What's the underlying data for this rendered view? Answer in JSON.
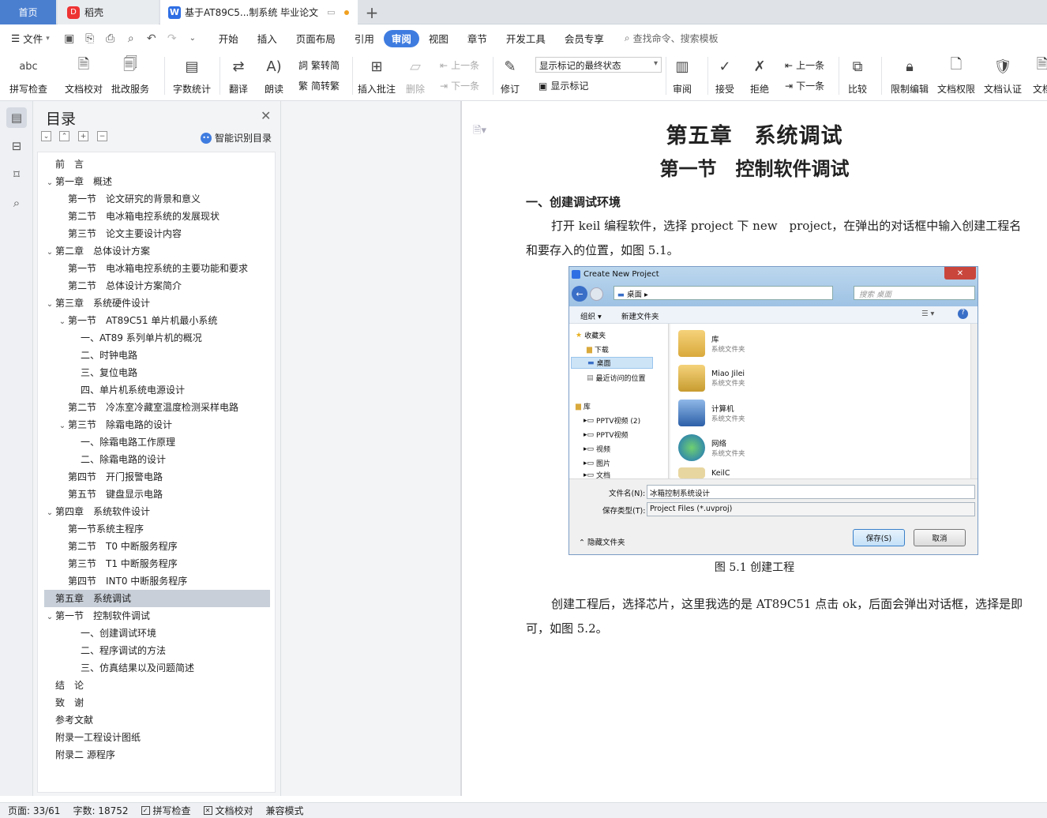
{
  "tabs": {
    "home": "首页",
    "daoke": "稻壳",
    "doc": "基于AT89C5...制系统 毕业论文"
  },
  "menu": {
    "file": "文件",
    "items": [
      "开始",
      "插入",
      "页面布局",
      "引用",
      "审阅",
      "视图",
      "章节",
      "开发工具",
      "会员专享"
    ],
    "active": "审阅",
    "search": "查找命令、搜索模板"
  },
  "ribbon": {
    "spell": "拼写检查",
    "proof": "文档校对",
    "annotate_service": "批改服务",
    "wordcount": "字数统计",
    "translate": "翻译",
    "read": "朗读",
    "trad2simp": "繁转简",
    "simp2trad": "简转繁",
    "insert_comment": "插入批注",
    "delete": "删除",
    "prev_comment": "上一条",
    "next_comment": "下一条",
    "revise": "修订",
    "track_mode": "显示标记的最终状态",
    "show_markup": "显示标记",
    "review": "审阅",
    "accept": "接受",
    "reject": "拒绝",
    "prev": "上一条",
    "next": "下一条",
    "compare": "比较",
    "restrict": "限制编辑",
    "permission": "文档权限",
    "certify": "文档认证",
    "more": "文档"
  },
  "toc": {
    "title": "目录",
    "smart": "智能识别目录",
    "items": [
      {
        "text": "前　言",
        "level": 0,
        "chev": ""
      },
      {
        "text": "第一章　概述",
        "level": 0,
        "chev": "v"
      },
      {
        "text": "第一节　论文研究的背景和意义",
        "level": 1,
        "chev": ""
      },
      {
        "text": "第二节　电冰箱电控系统的发展现状",
        "level": 1,
        "chev": ""
      },
      {
        "text": "第三节　论文主要设计内容",
        "level": 1,
        "chev": ""
      },
      {
        "text": "第二章　总体设计方案",
        "level": 0,
        "chev": "v"
      },
      {
        "text": "第一节　电冰箱电控系统的主要功能和要求",
        "level": 1,
        "chev": ""
      },
      {
        "text": "第二节　总体设计方案简介",
        "level": 1,
        "chev": ""
      },
      {
        "text": "第三章　系统硬件设计",
        "level": 0,
        "chev": "v"
      },
      {
        "text": "第一节　AT89C51 单片机最小系统",
        "level": 1,
        "chev": "v"
      },
      {
        "text": "一、AT89 系列单片机的概况",
        "level": 2,
        "chev": ""
      },
      {
        "text": "二、时钟电路",
        "level": 2,
        "chev": ""
      },
      {
        "text": "三、复位电路",
        "level": 2,
        "chev": ""
      },
      {
        "text": "四、单片机系统电源设计",
        "level": 2,
        "chev": ""
      },
      {
        "text": "第二节　冷冻室冷藏室温度检测采样电路",
        "level": 1,
        "chev": ""
      },
      {
        "text": "第三节　除霜电路的设计",
        "level": 1,
        "chev": "v"
      },
      {
        "text": "一、除霜电路工作原理",
        "level": 2,
        "chev": ""
      },
      {
        "text": "二、除霜电路的设计",
        "level": 2,
        "chev": ""
      },
      {
        "text": "第四节　开门报警电路",
        "level": 1,
        "chev": ""
      },
      {
        "text": "第五节　键盘显示电路",
        "level": 1,
        "chev": ""
      },
      {
        "text": "第四章　系统软件设计",
        "level": 0,
        "chev": "v"
      },
      {
        "text": "第一节系统主程序",
        "level": 1,
        "chev": ""
      },
      {
        "text": "第二节　T0 中断服务程序",
        "level": 1,
        "chev": ""
      },
      {
        "text": "第三节　T1 中断服务程序",
        "level": 1,
        "chev": ""
      },
      {
        "text": "第四节　INT0 中断服务程序",
        "level": 1,
        "chev": ""
      },
      {
        "text": "第五章　系统调试",
        "level": 0,
        "chev": "",
        "selected": true
      },
      {
        "text": "第一节　控制软件调试",
        "level": 0,
        "chev": "v"
      },
      {
        "text": "一、创建调试环境",
        "level": 2,
        "chev": ""
      },
      {
        "text": "二、程序调试的方法",
        "level": 2,
        "chev": ""
      },
      {
        "text": "三、仿真结果以及问题简述",
        "level": 2,
        "chev": ""
      },
      {
        "text": "结　论",
        "level": 0,
        "chev": ""
      },
      {
        "text": "致　谢",
        "level": 0,
        "chev": ""
      },
      {
        "text": "参考文献",
        "level": 0,
        "chev": ""
      },
      {
        "text": "附录一工程设计图纸",
        "level": 0,
        "chev": ""
      },
      {
        "text": "附录二 源程序",
        "level": 0,
        "chev": ""
      }
    ]
  },
  "doc": {
    "chapter": "第五章　系统调试",
    "section": "第一节　控制软件调试",
    "subhead": "一、创建调试环境",
    "para1": "打开 keil 编程软件，选择 project 下 new　project，在弹出的对话框中输入创建工程名和要存入的位置，如图 5.1。",
    "caption": "图 5.1 创建工程",
    "para2": "创建工程后，选择芯片，这里我选的是 AT89C51 点击 ok，后面会弹出对话框，选择是即可，如图 5.2。"
  },
  "dialog": {
    "title": "Create New Project",
    "address": "桌面",
    "search": "搜索 桌面",
    "organize": "组织 ▾",
    "newfolder": "新建文件夹",
    "nav": [
      "收藏夹",
      "下载",
      "桌面",
      "最近访问的位置",
      "库",
      "PPTV视频 (2)",
      "PPTV视频",
      "视频",
      "图片",
      "文档"
    ],
    "files": [
      {
        "name": "库",
        "type": "系统文件夹"
      },
      {
        "name": "Miao Jilei",
        "type": "系统文件夹"
      },
      {
        "name": "计算机",
        "type": "系统文件夹"
      },
      {
        "name": "网络",
        "type": "系统文件夹"
      },
      {
        "name": "KeilC",
        "type": ""
      }
    ],
    "filename_label": "文件名(N):",
    "filename": "冰箱控制系统设计",
    "type_label": "保存类型(T):",
    "type": "Project Files (*.uvproj)",
    "hide": "隐藏文件夹",
    "save": "保存(S)",
    "cancel": "取消"
  },
  "status": {
    "page": "页面: 33/61",
    "words": "字数: 18752",
    "spell": "拼写检查",
    "proof": "文档校对",
    "compat": "兼容模式"
  }
}
